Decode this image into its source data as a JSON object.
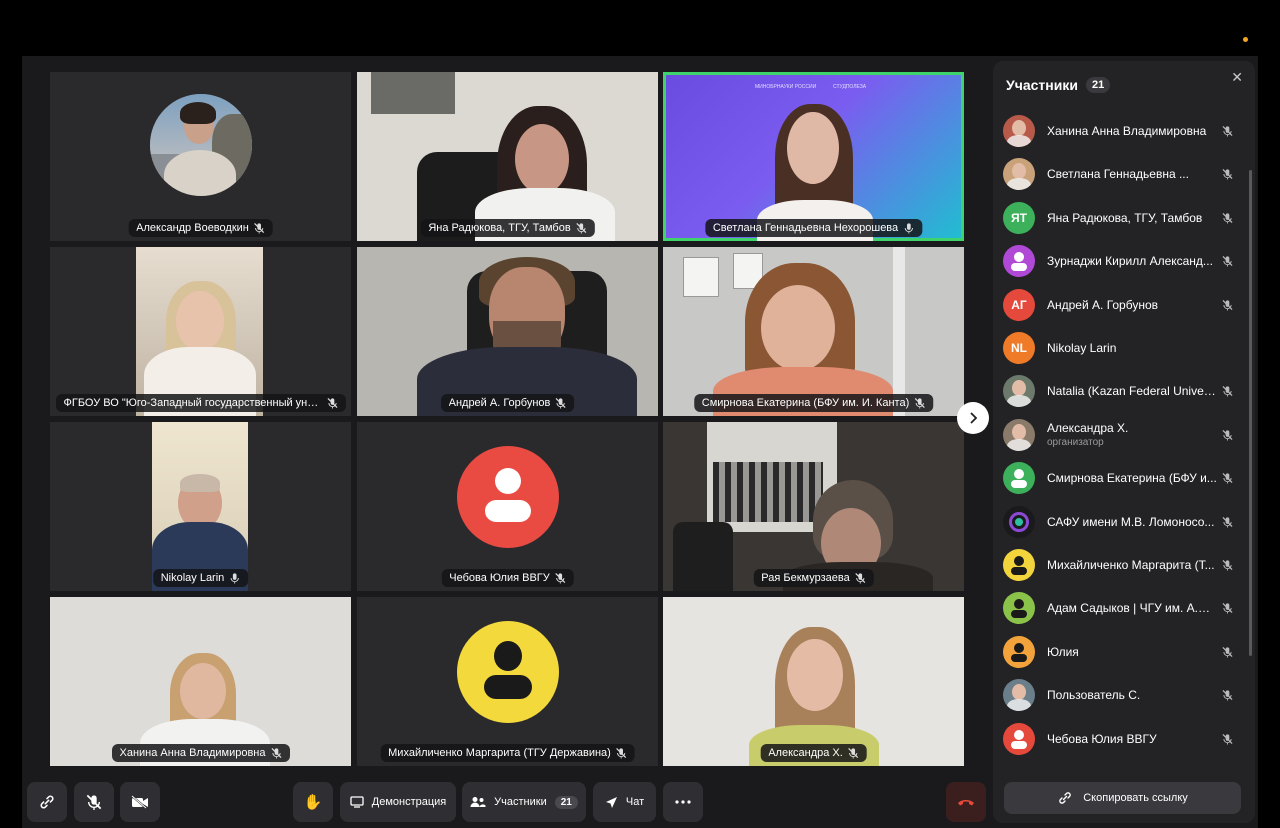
{
  "tiles": [
    {
      "name": "Александр Воеводкин",
      "muted": true
    },
    {
      "name": "Яна Радюкова, ТГУ, Тамбов",
      "muted": true
    },
    {
      "name": "Светлана Геннадьевна Нехорошева",
      "muted": false
    },
    {
      "name": "ФГБОУ ВО \"Юго-Западный государственный универси...",
      "muted": true
    },
    {
      "name": "Андрей А. Горбунов",
      "muted": true
    },
    {
      "name": "Смирнова Екатерина (БФУ им. И. Канта)",
      "muted": true
    },
    {
      "name": "Nikolay Larin",
      "muted": false
    },
    {
      "name": "Чебова Юлия ВВГУ",
      "muted": true
    },
    {
      "name": "Рая Бекмурзаева",
      "muted": true
    },
    {
      "name": "Ханина Анна Владимировна",
      "muted": true
    },
    {
      "name": "Михайличенко Маргарита (ТГУ Державина)",
      "muted": true
    },
    {
      "name": "Александра Х.",
      "muted": true
    }
  ],
  "banner": {
    "left": "МИНОБРНАУКИ РОССИИ",
    "right": "СТУДПОЛЕЗА"
  },
  "panel": {
    "title": "Участники",
    "count": "21",
    "participants": [
      {
        "name": "Ханина Анна Владимировна",
        "initials": "",
        "avatar": "photo",
        "color": "#b85a4a"
      },
      {
        "name": "Светлана Геннадьевна ...",
        "initials": "",
        "avatar": "photo",
        "color": "#c9a27a"
      },
      {
        "name": "Яна Радюкова, ТГУ, Тамбов",
        "initials": "ЯТ",
        "avatar": "initials",
        "color": "#3cb05a"
      },
      {
        "name": "Зурнаджи Кирилл Александ...",
        "initials": "",
        "avatar": "icon",
        "color": "#b04ad6"
      },
      {
        "name": "Андрей А. Горбунов",
        "initials": "АГ",
        "avatar": "initials",
        "color": "#e5493b"
      },
      {
        "name": "Nikolay Larin",
        "initials": "NL",
        "avatar": "initials",
        "color": "#ef7a28"
      },
      {
        "name": "Natalia (Kazan Federal Univer...",
        "initials": "",
        "avatar": "photo",
        "color": "#6b7a6a"
      },
      {
        "name": "Александра Х.",
        "sub": "организатор",
        "initials": "",
        "avatar": "photo",
        "color": "#8a7a6a"
      },
      {
        "name": "Смирнова Екатерина (БФУ и...",
        "initials": "",
        "avatar": "icon",
        "color": "#3cb05a"
      },
      {
        "name": "САФУ имени М.В. Ломоносо...",
        "initials": "",
        "avatar": "logo",
        "color": "#1a1a1c"
      },
      {
        "name": "Михайличенко Маргарита (Т...",
        "initials": "",
        "avatar": "icon",
        "color": "#f2d43c"
      },
      {
        "name": "Адам Садыков | ЧГУ им. А.А....",
        "initials": "",
        "avatar": "icon",
        "color": "#8bc34a"
      },
      {
        "name": "Юлия",
        "initials": "",
        "avatar": "icon",
        "color": "#f3a33b"
      },
      {
        "name": "Пользователь С.",
        "initials": "",
        "avatar": "photo",
        "color": "#6a7f8a"
      },
      {
        "name": "Чебова Юлия ВВГУ",
        "initials": "",
        "avatar": "icon",
        "color": "#e5493b"
      }
    ],
    "copy_link": "Скопировать ссылку"
  },
  "toolbar": {
    "demo": "Демонстрация",
    "participants": "Участники",
    "participants_count": "21",
    "chat": "Чат"
  }
}
